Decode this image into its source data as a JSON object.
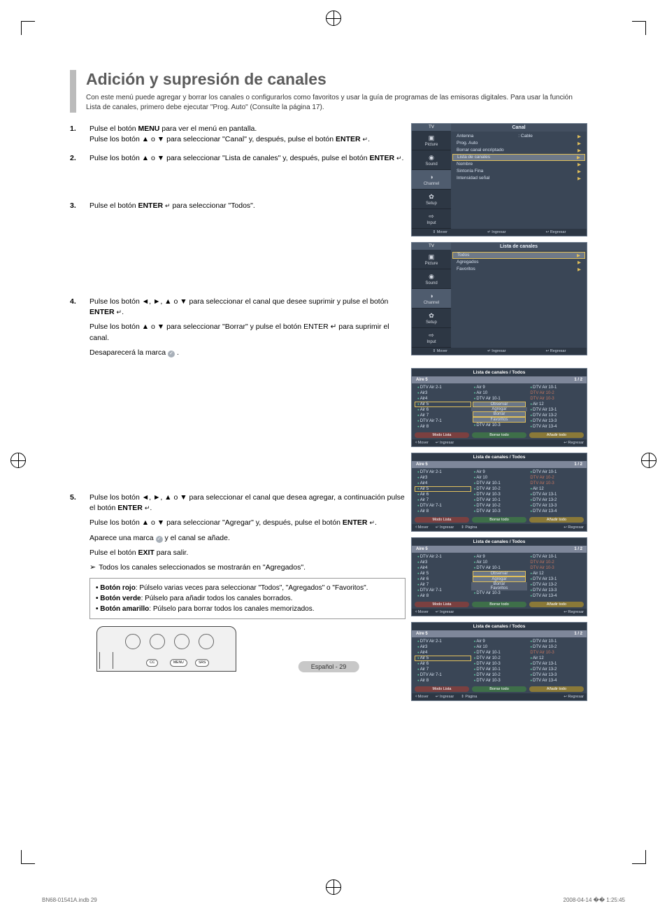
{
  "title": "Adición y supresión de canales",
  "intro": "Con este menú puede agregar y borrar los canales o configurarlos como favoritos y usar la guía de programas de las emisoras digitales. Para usar la función Lista de canales, primero debe ejecutar \"Prog. Auto\" (Consulte la página 17).",
  "steps": [
    "Pulse el botón MENU para ver el menú en pantalla.\nPulse los botón ▲ o ▼ para seleccionar \"Canal\" y, después, pulse el botón ENTER ↵.",
    "Pulse los botón ▲ o ▼ para seleccionar \"Lista de canales\" y, después, pulse el botón ENTER ↵.",
    "Pulse el botón ENTER ↵ para seleccionar \"Todos\".",
    "Pulse los botón ◄, ►, ▲ o ▼ para seleccionar el canal que desee suprimir y pulse el botón ENTER ↵.",
    "Pulse los botón ◄, ►, ▲ o ▼ para seleccionar el canal que desea agregar, a continuación pulse el botón ENTER ↵."
  ],
  "step4b": "Pulse los botón ▲ o ▼ para seleccionar \"Borrar\" y pulse el botón ENTER ↵ para suprimir el canal.",
  "step4c": "Desaparecerá la marca ✓ .",
  "step5b": "Pulse los botón ▲ o ▼ para seleccionar \"Agregar\" y, después, pulse el botón ENTER ↵.",
  "step5c": "Aparece una marca ✓ y  el canal se añade.",
  "step5d": "Pulse el botón EXIT para salir.",
  "step5note": "Todos los canales seleccionados se mostrarán en \"Agregados\".",
  "colorBox": {
    "red": "Botón rojo: Púlselo varias veces para seleccionar \"Todos\", \"Agregados\" o \"Favoritos\".",
    "green": "Botón verde: Púlselo para añadir todos los canales borrados.",
    "yellow": "Botón amarillo: Púlselo para borrar todos los canales memorizados."
  },
  "osd1": {
    "tv": "TV",
    "sideTabs": [
      "Picture",
      "Sound",
      "Channel",
      "Setup",
      "Input"
    ],
    "header": "Canal",
    "items": [
      {
        "l": "Antenna",
        "r": ": Cable"
      },
      {
        "l": "Prog. Auto",
        "r": ""
      },
      {
        "l": "Borrar canal encriptado",
        "r": ""
      },
      {
        "l": "Lista de canales",
        "r": ""
      },
      {
        "l": "Nombre",
        "r": ""
      },
      {
        "l": "Sintonía Fina",
        "r": ""
      },
      {
        "l": "Intensidad señal",
        "r": ""
      }
    ],
    "footer": [
      "⇕ Mover",
      "↵ Ingresar",
      "↩ Regresar"
    ]
  },
  "osd2": {
    "tv": "TV",
    "sideTabs": [
      "Picture",
      "Sound",
      "Channel",
      "Setup",
      "Input"
    ],
    "header": "Lista de canales",
    "items": [
      "Todos",
      "Agregados",
      "Favoritos"
    ],
    "footer": [
      "⇕ Mover",
      "↵ Ingresar",
      "↩ Regresar"
    ]
  },
  "clistCommon": {
    "title": "Lista de canales / Todos",
    "sub": "Aire 5",
    "page": "1 / 2",
    "pills": [
      "Modo Lista",
      "Borrar todo",
      "Añadir todo"
    ]
  },
  "clist3": {
    "col1": [
      "DTV Air 2-1",
      "Air3",
      "Air4",
      "Air 5",
      "Air 6",
      "Air 7",
      "DTV Air 7-1",
      "Air 8"
    ],
    "col2": [
      "Air 9",
      "Air 10",
      "DTV Air 10-1",
      "Observar",
      "Agregar",
      "Borrar",
      "Favoritos",
      "DTV Air 10-3"
    ],
    "col3": [
      "DTV Air 10-1",
      "DTV Air 10-2",
      "DTV Air 10-3",
      "Air 12",
      "DTV Air 13-1",
      "DTV Air 13-2",
      "DTV Air 13-3",
      "DTV Air 13-4"
    ],
    "footer": [
      "✧Mover",
      "↵ Ingresar",
      "↩ Regresar"
    ]
  },
  "clist4": {
    "col1": [
      "DTV Air 2-1",
      "Air3",
      "Air4",
      "Air 5",
      "Air 6",
      "Air 7",
      "DTV Air 7-1",
      "Air 8"
    ],
    "col2": [
      "Air 9",
      "Air 10",
      "DTV Air 10-1",
      "DTV Air 10-2",
      "DTV Air 10-3",
      "DTV Air 10-1",
      "DTV Air 10-2",
      "DTV Air 10-3"
    ],
    "col3": [
      "DTV Air 10-1",
      "DTV Air 10-2",
      "DTV Air 10-3",
      "Air 12",
      "DTV Air 13-1",
      "DTV Air 13-2",
      "DTV Air 13-3",
      "DTV Air 13-4"
    ],
    "footer": [
      "✧Mover",
      "↵ Ingresar",
      "⇕ Página",
      "↩ Regresar"
    ]
  },
  "clist5": {
    "col1": [
      "DTV Air 2-1",
      "Air3",
      "Air4",
      "Air 5",
      "Air 6",
      "Air 7",
      "DTV Air 7-1",
      "Air 8"
    ],
    "col2": [
      "Air 9",
      "Air 10",
      "DTV Air 10-1",
      "Observar",
      "Agregar",
      "Borrar",
      "Favoritos",
      "DTV Air 10-3"
    ],
    "col3": [
      "DTV Air 10-1",
      "DTV Air 10-2",
      "DTV Air 10-3",
      "Air 12",
      "DTV Air 13-1",
      "DTV Air 13-2",
      "DTV Air 13-3",
      "DTV Air 13-4"
    ],
    "footer": [
      "✧Mover",
      "↵ Ingresar",
      "↩ Regresar"
    ]
  },
  "clist6": {
    "col1": [
      "DTV Air 2-1",
      "Air3",
      "Air4",
      "Air 5",
      "Air 6",
      "Air 7",
      "DTV Air 7-1",
      "Air 8"
    ],
    "col2": [
      "Air 9",
      "Air 10",
      "DTV Air 10-1",
      "DTV Air 10-2",
      "DTV Air 10-3",
      "DTV Air 10-1",
      "DTV Air 10-2",
      "DTV Air 10-3"
    ],
    "col3": [
      "DTV Air 10-1",
      "DTV Air 10-2",
      "DTV Air 10-3",
      "Air 12",
      "DTV Air 13-1",
      "DTV Air 13-2",
      "DTV Air 13-3",
      "DTV Air 13-4"
    ],
    "footer": [
      "✧Mover",
      "↵ Ingresar",
      "⇕ Página",
      "↩ Regresar"
    ]
  },
  "remoteButtons": [
    "CC",
    "MENU",
    "SRS"
  ],
  "pageNum": "Español - 29",
  "docFile": "BN68-01541A.indb   29",
  "docTime": "2008-04-14   �� 1:25:45"
}
